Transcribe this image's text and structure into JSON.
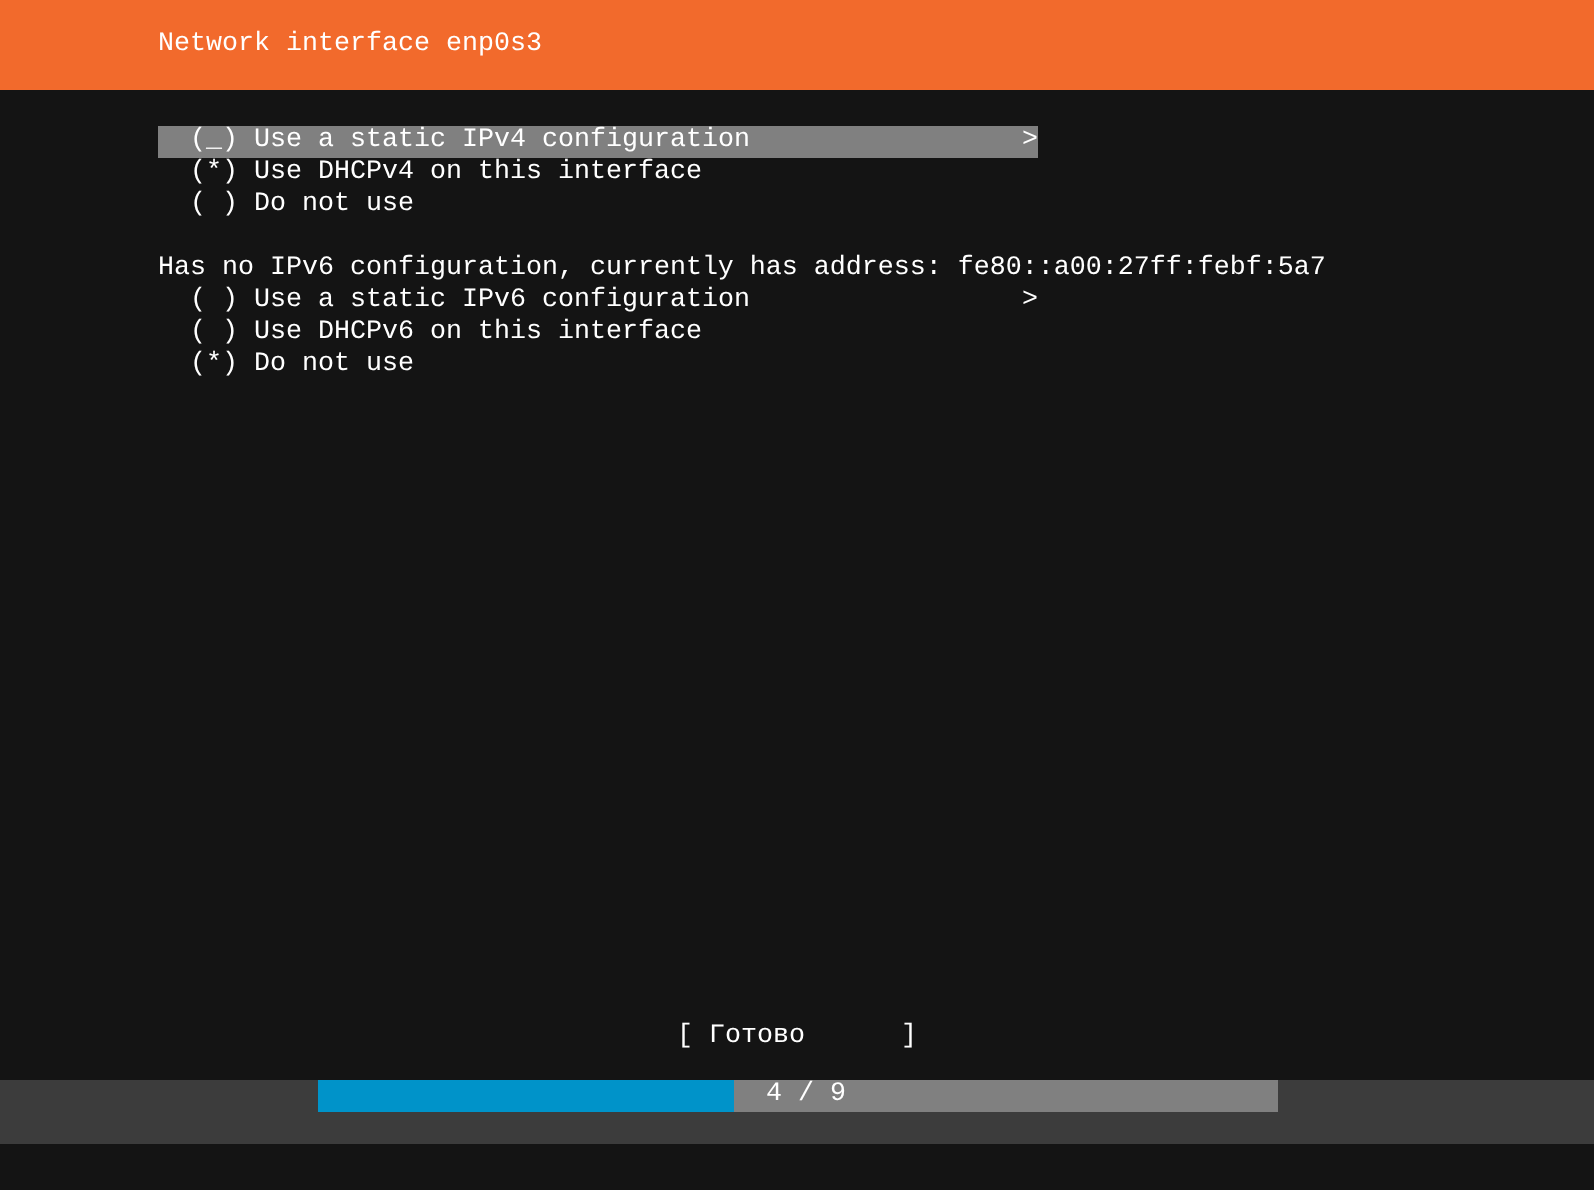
{
  "header": {
    "title": "Network interface enp0s3"
  },
  "ipv4": {
    "options": [
      {
        "radio": "(_)",
        "label": "Use a static IPv4 configuration",
        "arrow": ">",
        "selected": true
      },
      {
        "radio": "(*)",
        "label": "Use DHCPv4 on this interface",
        "selected": false
      },
      {
        "radio": "( )",
        "label": "Do not use",
        "selected": false
      }
    ]
  },
  "ipv6": {
    "note": "Has no IPv6 configuration, currently has address: fe80::a00:27ff:febf:5a7",
    "options": [
      {
        "radio": "( )",
        "label": "Use a static IPv6 configuration",
        "arrow": ">",
        "selected": false
      },
      {
        "radio": "( )",
        "label": "Use DHCPv6 on this interface",
        "selected": false
      },
      {
        "radio": "(*)",
        "label": "Do not use",
        "selected": false
      }
    ]
  },
  "done_button": {
    "left": "[",
    "label": "Готово",
    "right": "]"
  },
  "progress": {
    "level": 0.433,
    "text": "4 / 9"
  }
}
